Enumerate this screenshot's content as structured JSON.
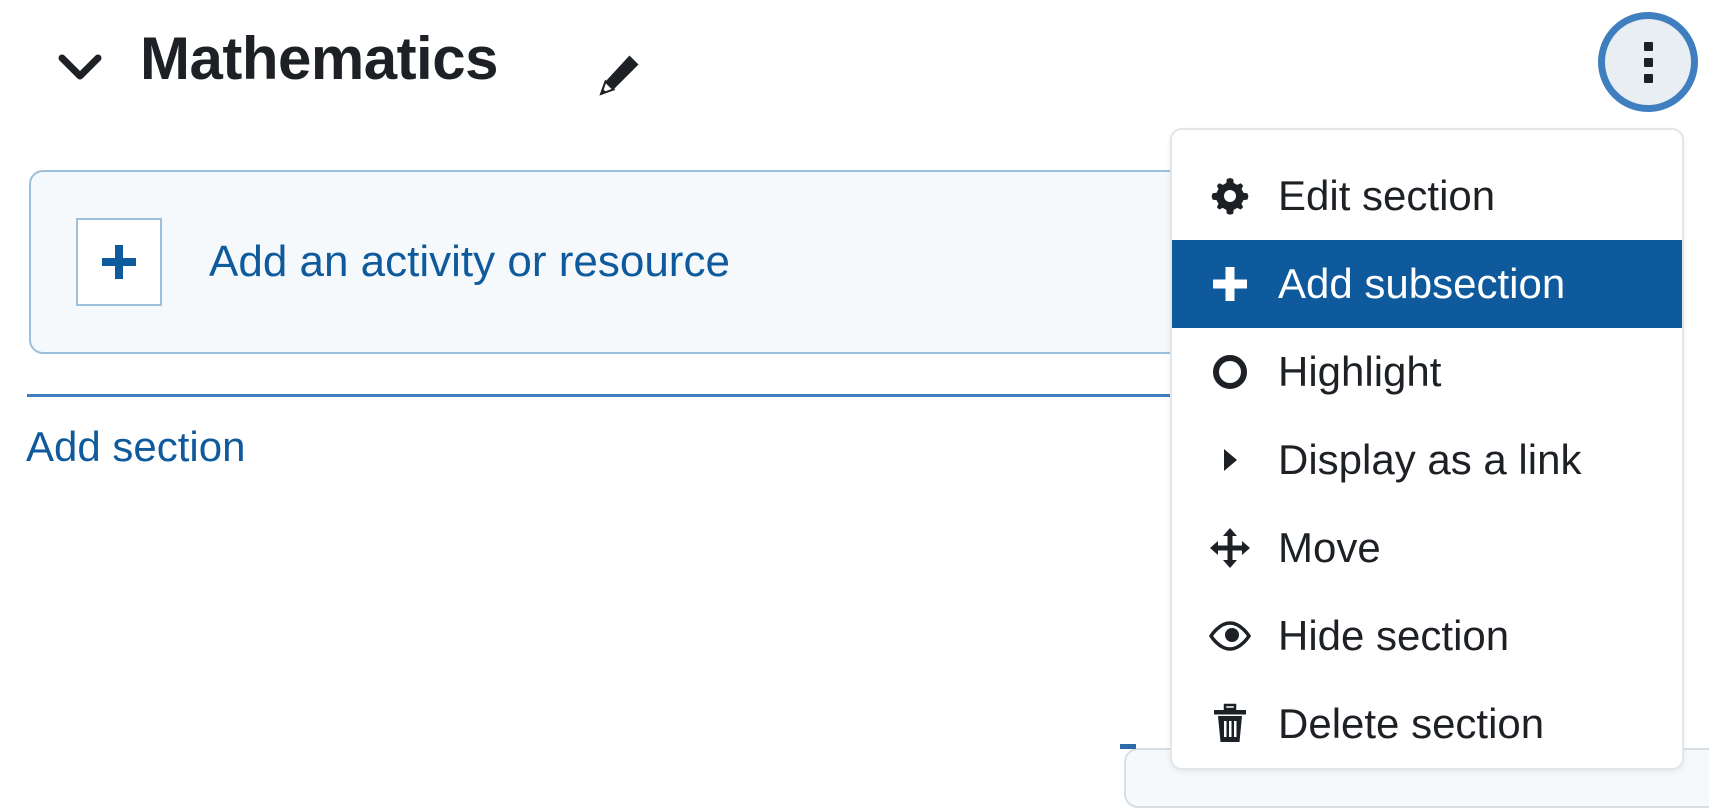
{
  "section": {
    "title": "Mathematics",
    "collapse_icon": "chevron-down-icon",
    "edit_icon": "pencil-icon"
  },
  "actions": {
    "button_icon": "three-dots-vertical-icon",
    "accent_color": "#3f7fbf"
  },
  "activity": {
    "plus_icon": "plus-icon",
    "label": "Add an activity or resource"
  },
  "add_section": {
    "label": "Add section"
  },
  "menu": {
    "highlight_color": "#0f5a9c",
    "items": [
      {
        "label": "Edit section",
        "icon": "gear-icon",
        "active": false
      },
      {
        "label": "Add subsection",
        "icon": "plus-icon",
        "active": true
      },
      {
        "label": "Highlight",
        "icon": "circle-icon",
        "active": false
      },
      {
        "label": "Display as a link",
        "icon": "triangle-right-icon",
        "active": false
      },
      {
        "label": "Move",
        "icon": "move-arrows-icon",
        "active": false
      },
      {
        "label": "Hide section",
        "icon": "eye-icon",
        "active": false
      },
      {
        "label": "Delete section",
        "icon": "trash-icon",
        "active": false
      }
    ]
  }
}
